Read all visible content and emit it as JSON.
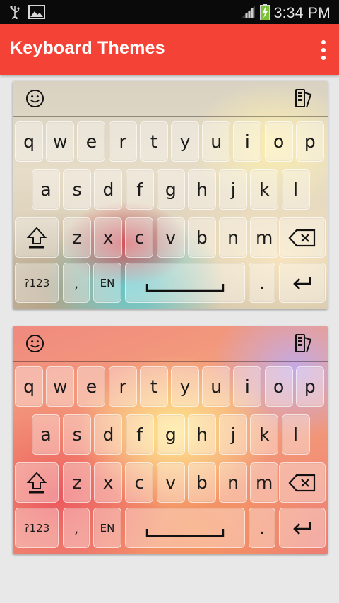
{
  "status_bar": {
    "time": "3:34 PM",
    "icons": [
      "usb-icon",
      "image-icon",
      "signal-icon",
      "battery-charging-icon"
    ]
  },
  "app_bar": {
    "title": "Keyboard Themes",
    "menu_icon": "overflow-menu-icon"
  },
  "keyboard": {
    "row1": [
      "q",
      "w",
      "e",
      "r",
      "t",
      "y",
      "u",
      "i",
      "o",
      "p"
    ],
    "row2": [
      "a",
      "s",
      "d",
      "f",
      "g",
      "h",
      "j",
      "k",
      "l"
    ],
    "row3": [
      "z",
      "x",
      "c",
      "v",
      "b",
      "n",
      "m"
    ],
    "symbols_key": "?123",
    "comma_key": ",",
    "language_key": "EN",
    "period_key": ".",
    "suggestion_icons": [
      "emoji-icon",
      "theme-palette-icon"
    ]
  },
  "themes": [
    {
      "name": "theme-preview-1",
      "accent_colors": [
        "#5ac8cd",
        "#dc3c46",
        "#fff0aa"
      ]
    },
    {
      "name": "theme-preview-2",
      "accent_colors": [
        "#eb505a",
        "#ffeb8c",
        "#beaaf0"
      ]
    }
  ],
  "colors": {
    "app_bar": "#f44336",
    "status_bar": "#0a0a0a",
    "background": "#e8e8e8"
  }
}
